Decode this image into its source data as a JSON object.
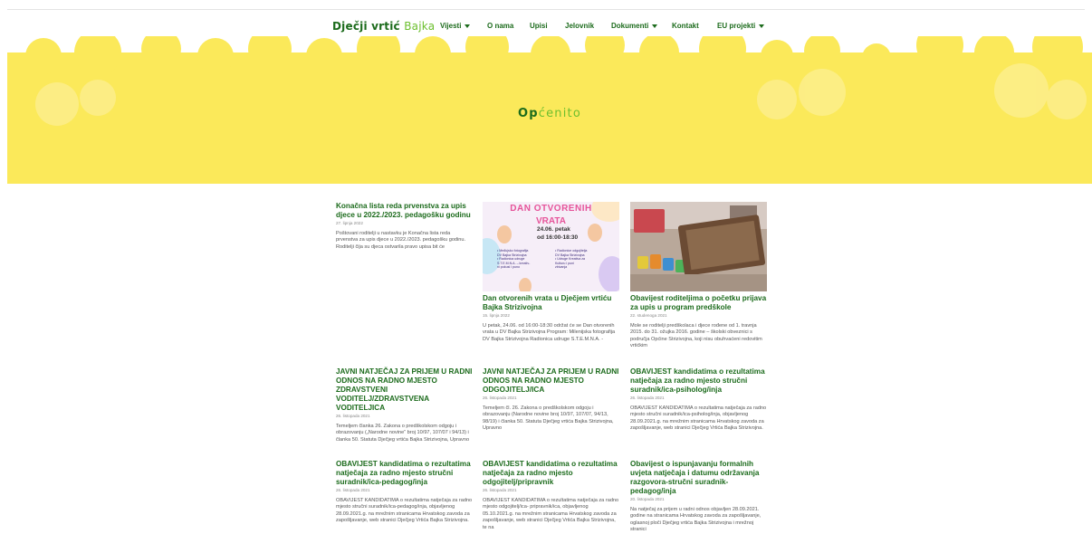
{
  "header": {
    "logo_main": "Dječji vrtić",
    "logo_accent": "Bajka",
    "nav": [
      {
        "label": "Vijesti",
        "dropdown": true
      },
      {
        "label": "O nama",
        "dropdown": false
      },
      {
        "label": "Upisi",
        "dropdown": false
      },
      {
        "label": "Jelovnik",
        "dropdown": false
      },
      {
        "label": "Dokumenti",
        "dropdown": true
      },
      {
        "label": "Kontakt",
        "dropdown": false
      },
      {
        "label": "EU projekti",
        "dropdown": true
      }
    ]
  },
  "hero": {
    "title_main": "Op",
    "title_accent": "ćenito",
    "background_color": "#fbe95a"
  },
  "colors": {
    "brand_green": "#1c6b1c",
    "accent_green": "#6cbf2e",
    "hero_yellow": "#fbe95a"
  },
  "poster": {
    "heading": "DAN OTVORENIH",
    "heading2": "VRATA",
    "date": "24.06. petak",
    "time": "od 16:00-18:30",
    "list_left": "• Međujsko fotografija\n  DV Bajka Strizivojna\n• Radionica udruge\n  S.T.E.M.N.A. – kreativ-\n  ni pokusi i puno",
    "list_right": "• Radionice odgojitelja\n  DV Bajka Strizivojna\n• Udruge Kreativa za\n  Kulturu i puni\n  zbivanja"
  },
  "posts": [
    {
      "title": "Konačna lista reda prvenstva za upis djece u 2022./2023. pedagošku godinu",
      "date": "27. lipnja 2022",
      "excerpt": "Poštovani roditelji u nastavku je Konačna lista reda prvenstva za upis djece u 2022./2023. pedagošku godinu. Roditelji čija su djeca ostvarila pravo upisa bit će"
    },
    {
      "title": "Dan otvorenih vrata u Dječjem vrtiću Bajka Strizivojna",
      "date": "15. lipnja 2022",
      "excerpt": "U petak, 24.06. od 16:00-18:30 održat će se Dan otvorenih vrata u DV Bajka Strizivojna Program: Milenijska fotografija DV Bajka Strizivojna Radionica udruge S.T.E.M.N.A. -"
    },
    {
      "title": "Obavijest roditeljima o početku prijava za upis u program predškole",
      "date": "22. studenoga 2021",
      "excerpt": "Mole se roditelji predškolaca i djece rođene od 1. travnja 2015. do 31. ožujka 2016. godine – školski obveznici s područja Općine Strizivojna, koji nisu obuhvaćeni redovitim vrtićkim"
    },
    {
      "title": "JAVNI NATJEČAJ ZA PRIJEM U RADNI ODNOS NA RADNO MJESTO ZDRAVSTVENI VODITELJ/ZDRAVSTVENA VODITELJICA",
      "date": "26. listopada 2021",
      "excerpt": "Temeljem članka 26. Zakona o predškolskom odgoju i obrazovanju („Narodne novine“ broj 10/97, 107/07 i 94/13) i članka 50. Statuta Dječjeg vrtića Bajka Strizivojna, Upravno"
    },
    {
      "title": "JAVNI  NATJEČAJ ZA PRIJEM U RADNI ODNOS NA RADNO MJESTO ODGOJITELJ/ICA",
      "date": "26. listopada 2021",
      "excerpt": "Temeljem čl. 26. Zakona o predškolskom odgoju i obrazovanju (Narodne novine broj 10/97, 107/07, 94/13, 98/19) i članka 50. Statuta Dječjeg vrtića Bajka Strizivojna, Upravno"
    },
    {
      "title": "OBAVIJEST kandidatima o rezultatima natječaja za radno mjesto stručni suradnik/ica-psiholog/inja",
      "date": "26. listopada 2021",
      "excerpt": "OBAVIJEST KANDIDATIMA o rezultatima natječaja za radno mjesto stručni suradnik/ica-psiholog/inja, objavljenog 28.09.2021.g. na mrežnim stranicama Hrvatskog zavoda za zapošljavanje, web stranici Dječjeg Vrtića Bajka Strizivojna."
    },
    {
      "title": "OBAVIJEST kandidatima o rezultatima natječaja za radno mjesto stručni suradnik/ica-pedagog/inja",
      "date": "26. listopada 2021",
      "excerpt": "OBAVIJEST KANDIDATIMA o rezultatima natječaja za radno mjesto stručni suradnik/ica-pedagog/inja, objavljenog 28.09.2021.g. na mrežnim stranicama Hrvatskog zavoda za zapošljavanje, web stranici Dječjeg Vrtića Bajka Strizivojna."
    },
    {
      "title": "OBAVIJEST kandidatima o rezultatima natječaja za radno mjesto odgojitelj/pripravnik",
      "date": "26. listopada 2021",
      "excerpt": "OBAVIJEST KANDIDATIMA o rezultatima natječaja za radno mjesto odgojitelj/ica- pripravnik/ica,  objavljenog 05.10.2021.g. na mrežnim stranicama Hrvatskog zavoda za zapošljavanje, web stranici Dječjeg Vrtića Bajka Strizivojna, te na"
    },
    {
      "title": "Obavijest o ispunjavanju formalnih uvjeta natječaja i datumu održavanja razgovora-stručni suradnik-pedagog/inja",
      "date": "20. listopada 2021",
      "excerpt": "Na natječaj za prijem u radni odnos objavljen 28.09.2021. godine na stranicama Hrvatskog zavoda za zapošljavanje, oglasnoj ploči Dječjeg vrtića Bajka Strizivojna i mrežnoj stranici"
    }
  ]
}
